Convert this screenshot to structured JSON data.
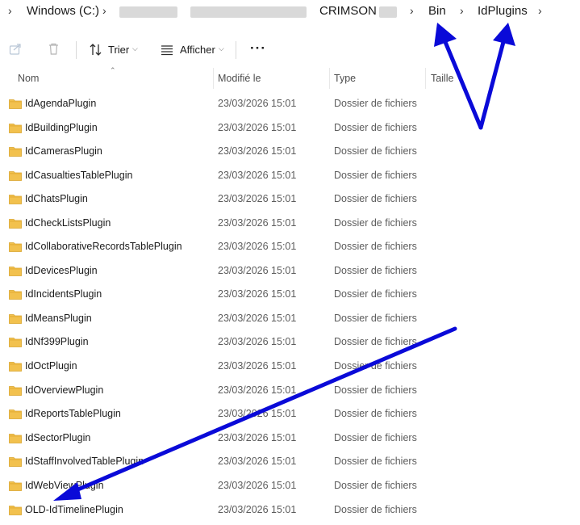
{
  "breadcrumb": {
    "items": [
      "Windows (C:)",
      "CRIMSON 8.",
      "Bin",
      "IdPlugins"
    ]
  },
  "toolbar": {
    "sort_label": "Trier",
    "view_label": "Afficher",
    "more_label": "···"
  },
  "columns": {
    "name": "Nom",
    "modified": "Modifié le",
    "type": "Type",
    "size": "Taille"
  },
  "files": [
    {
      "name": "IdAgendaPlugin",
      "modified": "23/03/2026 15:01",
      "type": "Dossier de fichiers"
    },
    {
      "name": "IdBuildingPlugin",
      "modified": "23/03/2026 15:01",
      "type": "Dossier de fichiers"
    },
    {
      "name": "IdCamerasPlugin",
      "modified": "23/03/2026 15:01",
      "type": "Dossier de fichiers"
    },
    {
      "name": "IdCasualtiesTablePlugin",
      "modified": "23/03/2026 15:01",
      "type": "Dossier de fichiers"
    },
    {
      "name": "IdChatsPlugin",
      "modified": "23/03/2026 15:01",
      "type": "Dossier de fichiers"
    },
    {
      "name": "IdCheckListsPlugin",
      "modified": "23/03/2026 15:01",
      "type": "Dossier de fichiers"
    },
    {
      "name": "IdCollaborativeRecordsTablePlugin",
      "modified": "23/03/2026 15:01",
      "type": "Dossier de fichiers"
    },
    {
      "name": "IdDevicesPlugin",
      "modified": "23/03/2026 15:01",
      "type": "Dossier de fichiers"
    },
    {
      "name": "IdIncidentsPlugin",
      "modified": "23/03/2026 15:01",
      "type": "Dossier de fichiers"
    },
    {
      "name": "IdMeansPlugin",
      "modified": "23/03/2026 15:01",
      "type": "Dossier de fichiers"
    },
    {
      "name": "IdNf399Plugin",
      "modified": "23/03/2026 15:01",
      "type": "Dossier de fichiers"
    },
    {
      "name": "IdOctPlugin",
      "modified": "23/03/2026 15:01",
      "type": "Dossier de fichiers"
    },
    {
      "name": "IdOverviewPlugin",
      "modified": "23/03/2026 15:01",
      "type": "Dossier de fichiers"
    },
    {
      "name": "IdReportsTablePlugin",
      "modified": "23/03/2026 15:01",
      "type": "Dossier de fichiers"
    },
    {
      "name": "IdSectorPlugin",
      "modified": "23/03/2026 15:01",
      "type": "Dossier de fichiers"
    },
    {
      "name": "IdStaffInvolvedTablePlugin",
      "modified": "23/03/2026 15:01",
      "type": "Dossier de fichiers"
    },
    {
      "name": "IdWebViewPlugin",
      "modified": "23/03/2026 15:01",
      "type": "Dossier de fichiers"
    },
    {
      "name": "OLD-IdTimelinePlugin",
      "modified": "23/03/2026 15:01",
      "type": "Dossier de fichiers"
    }
  ],
  "colors": {
    "folder": "#f2c14e",
    "folder_dark": "#d9a42b",
    "arrow": "#0a0ad8"
  },
  "icons": [
    "share-icon",
    "trash-icon",
    "sort-icon",
    "view-icon",
    "folder-icon"
  ]
}
